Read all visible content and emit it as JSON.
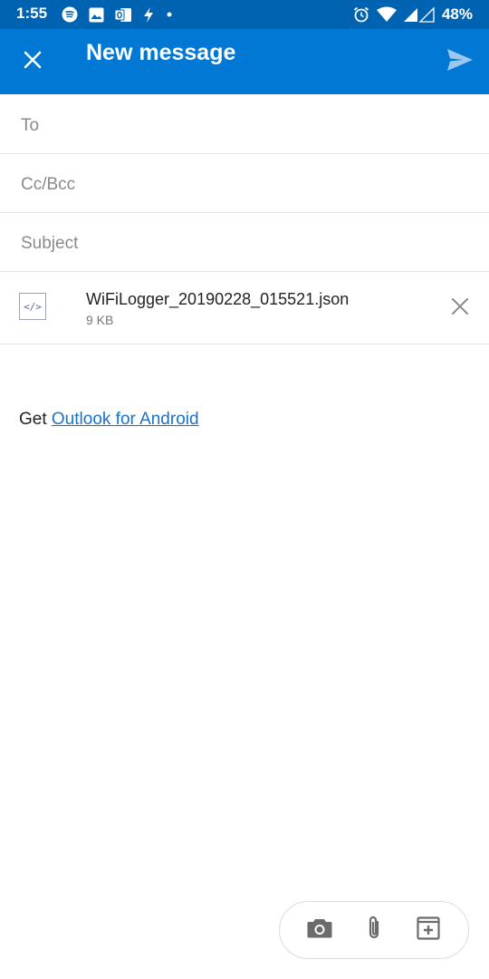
{
  "status_bar": {
    "time": "1:55",
    "battery": "48%",
    "icons": [
      "spotify-icon",
      "image-icon",
      "outlook-icon",
      "bolt-icon",
      "dot-icon",
      "alarm-icon",
      "wifi-icon",
      "signal-icon"
    ]
  },
  "app_bar": {
    "title": "New message",
    "close_icon": "close-icon",
    "send_icon": "send-icon",
    "background": "#0078d4"
  },
  "fields": {
    "to_placeholder": "To",
    "cc_bcc_placeholder": "Cc/Bcc",
    "subject_placeholder": "Subject",
    "to_value": "",
    "cc_bcc_value": "",
    "subject_value": ""
  },
  "attachment": {
    "icon_glyph": "</>",
    "file_name": "WiFiLogger_20190228_015521.json",
    "file_size": "9 KB"
  },
  "body": {
    "prefix": "Get",
    "link_text": "Outlook for Android",
    "link_color": "#1a73c9"
  },
  "toolbar": {
    "items": [
      "camera-icon",
      "paperclip-icon",
      "add-box-icon"
    ]
  }
}
